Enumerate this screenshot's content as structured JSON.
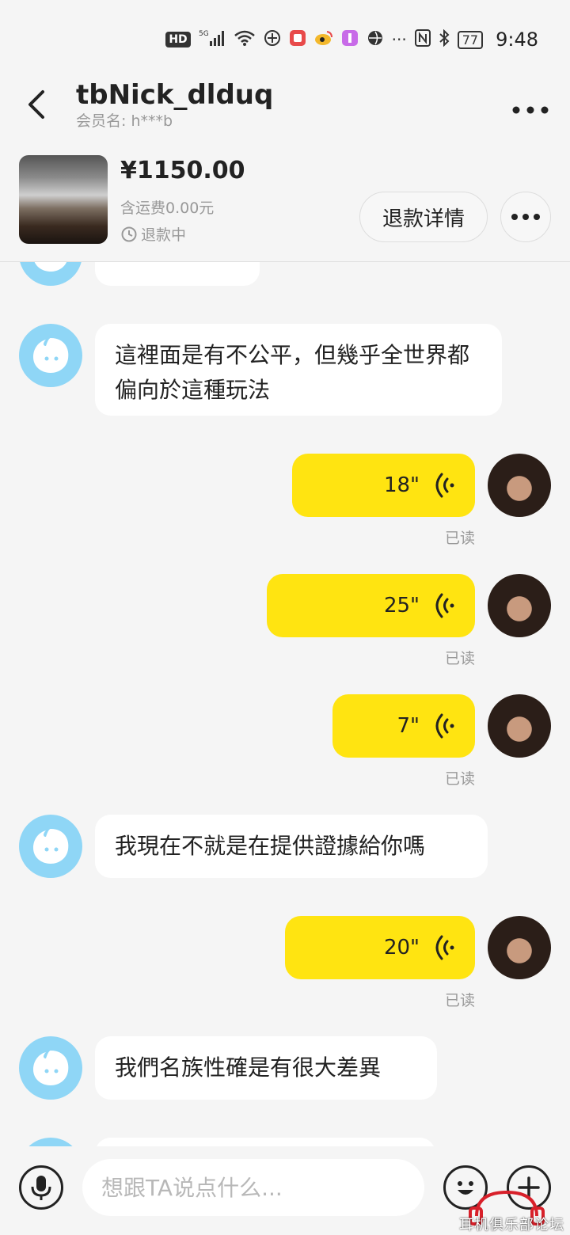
{
  "status_bar": {
    "hd": "HD",
    "signal": "5G",
    "battery": "77",
    "time": "9:48"
  },
  "header": {
    "nickname": "tbNick_dlduq",
    "member_label": "会员名:",
    "member_value": "h***b"
  },
  "order": {
    "price": "¥1150.00",
    "shipping": "含运费0.00元",
    "status": "退款中",
    "refund_button": "退款详情"
  },
  "messages": [
    {
      "side": "in",
      "text": "這裡面是有不公平，但幾乎全世界都偏向於這種玩法"
    },
    {
      "side": "out",
      "duration": "18\"",
      "read": "已读"
    },
    {
      "side": "out",
      "duration": "25\"",
      "read": "已读"
    },
    {
      "side": "out",
      "duration": "7\"",
      "read": "已读"
    },
    {
      "side": "in",
      "text": "我現在不就是在提供證據給你嗎"
    },
    {
      "side": "out",
      "duration": "20\"",
      "read": "已读"
    },
    {
      "side": "in",
      "text": "我們名族性確是有很大差異"
    }
  ],
  "input": {
    "placeholder": "想跟TA说点什么..."
  },
  "watermark": "耳机俱乐部论坛"
}
